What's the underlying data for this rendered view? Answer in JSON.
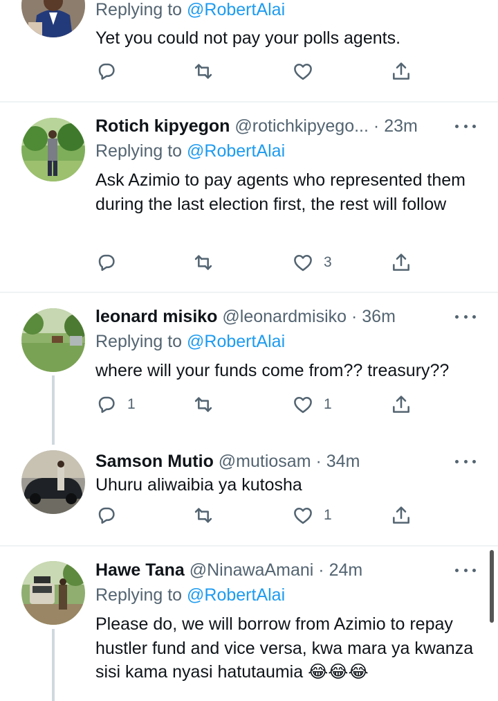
{
  "tweets": [
    {
      "name": "",
      "handle": "",
      "time": "",
      "replying_prefix": "Replying to",
      "mention": "@RobertAlai",
      "text": "Yet you could not pay your polls agents.",
      "reply_count": "",
      "retweet_count": "",
      "like_count": ""
    },
    {
      "name": "Rotich kipyegon",
      "handle": "@rotichkipyego...",
      "dot": "·",
      "time": "23m",
      "replying_prefix": "Replying to",
      "mention": "@RobertAlai",
      "text": "Ask Azimio to pay agents who represented them during the last election first, the rest will follow",
      "reply_count": "",
      "retweet_count": "",
      "like_count": "3"
    },
    {
      "name": "leonard misiko",
      "handle": "@leonardmisiko",
      "dot": "·",
      "time": "36m",
      "replying_prefix": "Replying to",
      "mention": "@RobertAlai",
      "text": "where will your funds come from?? treasury??",
      "reply_count": "1",
      "retweet_count": "",
      "like_count": "1"
    },
    {
      "name": "Samson Mutio",
      "handle": "@mutiosam",
      "dot": "·",
      "time": "34m",
      "text": "Uhuru aliwaibia ya kutosha",
      "reply_count": "",
      "retweet_count": "",
      "like_count": "1"
    },
    {
      "name": "Hawe Tana",
      "handle": "@NinawaAmani",
      "dot": "·",
      "time": "24m",
      "replying_prefix": "Replying to",
      "mention": "@RobertAlai",
      "text": "Please do, we will borrow from Azimio to repay hustler fund and vice versa, kwa mara ya kwanza sisi kama nyasi hatutaumia 😂😂😂"
    }
  ],
  "icons": {
    "reply": "reply-icon",
    "retweet": "retweet-icon",
    "like": "heart-icon",
    "share": "share-icon",
    "more": "more-icon"
  },
  "colors": {
    "link": "#1d9bf0",
    "secondary": "#536471",
    "text": "#0f1419",
    "divider": "#eff3f4",
    "thread_line": "#cfd9de"
  }
}
